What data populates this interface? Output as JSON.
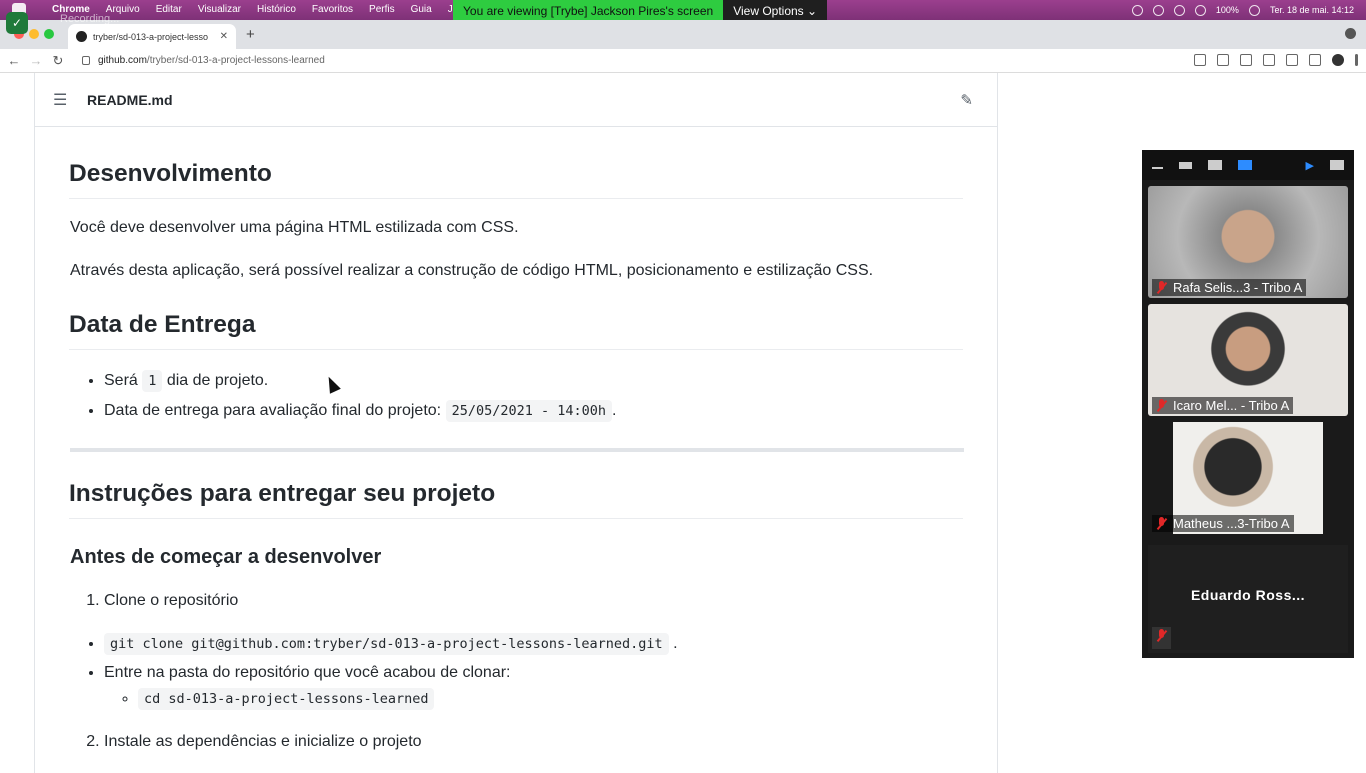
{
  "menubar": {
    "app": "Chrome",
    "items": [
      "Arquivo",
      "Editar",
      "Visualizar",
      "Histórico",
      "Favoritos",
      "Perfis",
      "Guia",
      "Janela"
    ],
    "battery": "100%",
    "datetime": "Ter. 18 de mai.  14:12",
    "recording": "Recording..."
  },
  "zoom": {
    "viewing": "You are viewing [Trybe] Jackson Pires's screen",
    "view_options": "View Options"
  },
  "browser": {
    "tab_title": "tryber/sd-013-a-project-lesso",
    "url_host": "github.com",
    "url_path": "/tryber/sd-013-a-project-lessons-learned"
  },
  "readme": {
    "filename": "README.md",
    "h_dev": "Desenvolvimento",
    "p1": "Você deve desenvolver uma página HTML estilizada com CSS.",
    "p2": "Através desta aplicação, será possível realizar a construção de código HTML, posicionamento e estilização CSS.",
    "h_entrega": "Data de Entrega",
    "li1_a": "Será",
    "li1_code": "1",
    "li1_b": "dia de projeto.",
    "li2_a": "Data de entrega para avaliação final do projeto:",
    "li2_code": "25/05/2021 - 14:00h",
    "li2_b": ".",
    "h_instr": "Instruções para entregar seu projeto",
    "h_antes": "Antes de começar a desenvolver",
    "step1": "Clone o repositório",
    "clone_code": "git clone git@github.com:tryber/sd-013-a-project-lessons-learned.git",
    "clone_dot": ".",
    "enter": "Entre na pasta do repositório que você acabou de clonar:",
    "cd_code": "cd sd-013-a-project-lessons-learned",
    "step2": "Instale as dependências e inicialize o projeto"
  },
  "participants": [
    {
      "name": "Rafa Selis...3 - Tribo A",
      "muted": true
    },
    {
      "name": "Icaro Mel... - Tribo A",
      "muted": true
    },
    {
      "name": "Matheus ...3-Tribo A",
      "muted": true
    },
    {
      "name": "Eduardo  Ross...",
      "muted": true
    }
  ]
}
